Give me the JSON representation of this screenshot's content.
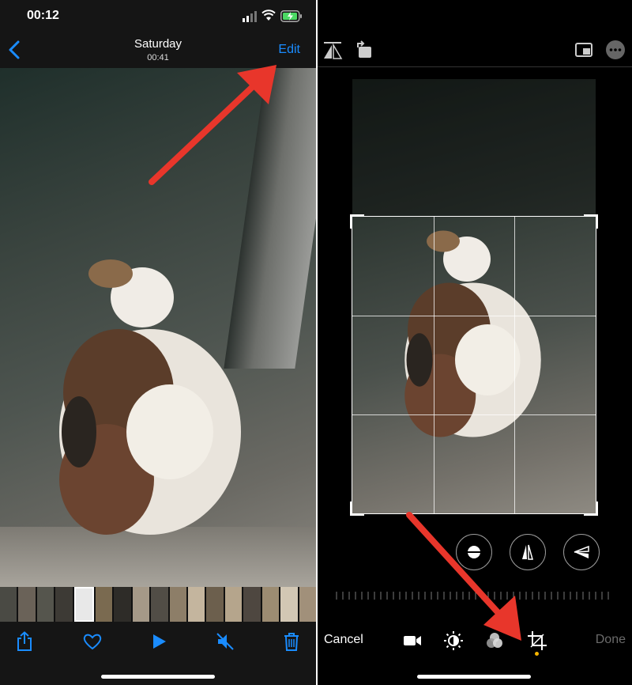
{
  "left": {
    "status": {
      "time": "00:12"
    },
    "nav": {
      "title": "Saturday",
      "subtitle": "00:41",
      "edit_label": "Edit",
      "back_icon": "chevron-left-icon"
    },
    "toolbar": {
      "icons": [
        "share-icon",
        "heart-icon",
        "play-icon",
        "mute-icon",
        "trash-icon"
      ]
    }
  },
  "right": {
    "top_icons": [
      "flip-icon",
      "rotate-icon",
      "aspect-ratio-icon",
      "more-icon"
    ],
    "adjust_buttons": [
      "straighten-icon",
      "vertical-perspective-icon",
      "horizontal-perspective-icon"
    ],
    "cancel_label": "Cancel",
    "done_label": "Done",
    "bottom_icons": [
      "video-icon",
      "adjust-icon",
      "filters-icon",
      "crop-icon"
    ],
    "active_tool": "crop"
  },
  "colors": {
    "accent": "#1a8cff",
    "arrow": "#e8362b",
    "active_dot": "#f5b400",
    "disabled": "#6b6b6b"
  }
}
